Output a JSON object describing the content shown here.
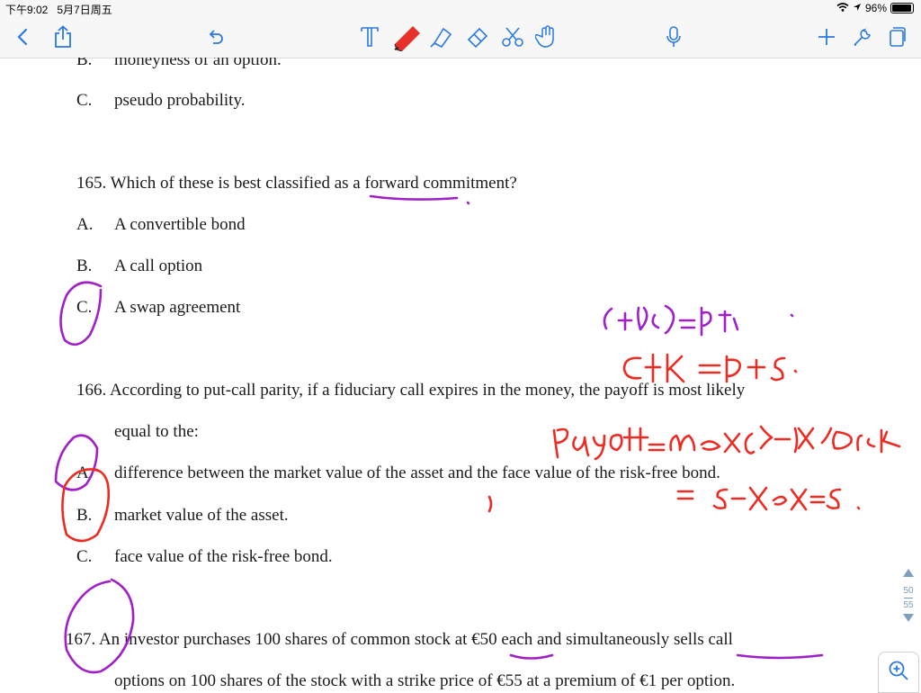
{
  "statusbar": {
    "time": "下午9:02",
    "date": "5月7日周五",
    "battery": "96%",
    "battery_level": 0.96
  },
  "toolbar": {
    "icons": [
      "back-icon",
      "share-icon",
      "undo-icon",
      "text-tool-icon",
      "pen-icon",
      "highlighter-icon",
      "eraser-icon",
      "scissors-icon",
      "hand-icon",
      "microphone-icon",
      "add-icon",
      "wrench-icon",
      "pages-icon"
    ],
    "accent": "#2a7ae2",
    "pen_color": "#e8312a"
  },
  "document": {
    "prev_q": {
      "b_label": "B.",
      "b_text": "moneyness of an option.",
      "c_label": "C.",
      "c_text": "pseudo probability."
    },
    "q165": {
      "stem": "165. Which of these is best classified as a forward commitment?",
      "a_label": "A.",
      "a_text": "A convertible bond",
      "b_label": "B.",
      "b_text": "A call option",
      "c_label": "C.",
      "c_text": "A swap agreement"
    },
    "q166": {
      "stem1": "166. According to put-call parity, if a fiduciary call expires in the money, the payoff is most likely",
      "stem2": "equal to the:",
      "a_label": "A.",
      "a_text": "difference between the market value of the asset and the face value of the risk-free bond.",
      "b_label": "B.",
      "b_text": "market value of the asset.",
      "c_label": "C.",
      "c_text": "face value of the risk-free bond."
    },
    "q167": {
      "stem1": "167. An investor purchases 100 shares of common stock at €50 each and simultaneously sells call",
      "stem2": "options on 100 shares of the stock with a strike price of €55 at a premium of €1 per option."
    }
  },
  "pager": {
    "current": "50",
    "total": "55"
  },
  "ink_colors": {
    "purple": "#a020c8",
    "red": "#ee2b22"
  }
}
